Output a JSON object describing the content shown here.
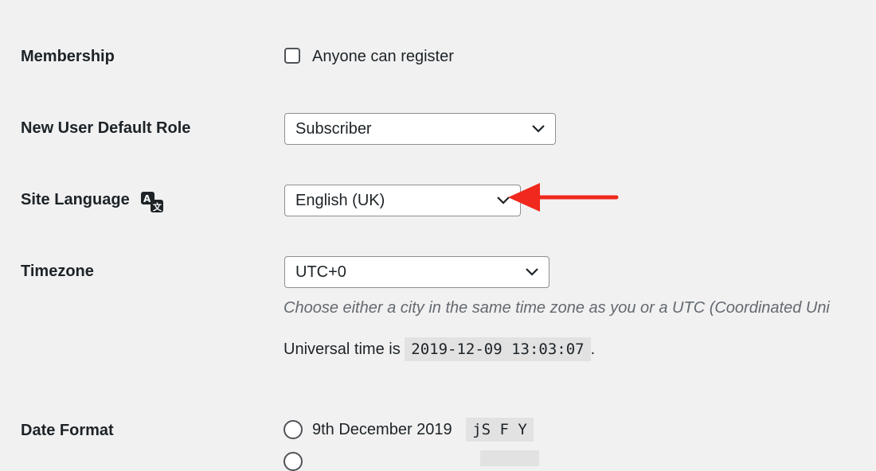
{
  "membership": {
    "label": "Membership",
    "checkbox_label": "Anyone can register",
    "checked": false
  },
  "default_role": {
    "label": "New User Default Role",
    "value": "Subscriber"
  },
  "site_language": {
    "label": "Site Language",
    "icon": "translation-icon",
    "value": "English (UK)",
    "annotation": "red-arrow-pointing-left"
  },
  "timezone": {
    "label": "Timezone",
    "value": "UTC+0",
    "description": "Choose either a city in the same time zone as you or a UTC (Coordinated Uni",
    "universal_prefix": "Universal time is",
    "universal_value": "2019-12-09 13:03:07",
    "universal_suffix": "."
  },
  "date_format": {
    "label": "Date Format",
    "options": [
      {
        "label": "9th December 2019",
        "code": "jS F Y"
      }
    ]
  },
  "colors": {
    "background": "#f1f1f1",
    "annotation_arrow": "#f0281e"
  }
}
